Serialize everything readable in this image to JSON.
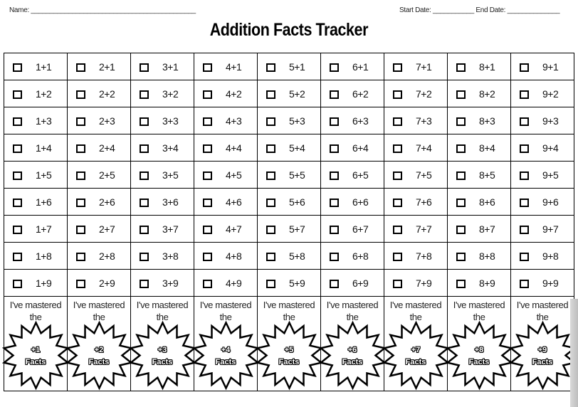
{
  "header": {
    "name_label": "Name: ____________________________________________",
    "dates_label": "Start Date: ___________  End Date: ______________",
    "title": "Addition Facts Tracker"
  },
  "grid": {
    "rows": [
      [
        "1+1",
        "2+1",
        "3+1",
        "4+1",
        "5+1",
        "6+1",
        "7+1",
        "8+1",
        "9+1"
      ],
      [
        "1+2",
        "2+2",
        "3+2",
        "4+2",
        "5+2",
        "6+2",
        "7+2",
        "8+2",
        "9+2"
      ],
      [
        "1+3",
        "2+3",
        "3+3",
        "4+3",
        "5+3",
        "6+3",
        "7+3",
        "8+3",
        "9+3"
      ],
      [
        "1+4",
        "2+4",
        "3+4",
        "4+4",
        "5+4",
        "6+4",
        "7+4",
        "8+4",
        "9+4"
      ],
      [
        "1+5",
        "2+5",
        "3+5",
        "4+5",
        "5+5",
        "6+5",
        "7+5",
        "8+5",
        "9+5"
      ],
      [
        "1+6",
        "2+6",
        "3+6",
        "4+6",
        "5+6",
        "6+6",
        "7+6",
        "8+6",
        "9+6"
      ],
      [
        "1+7",
        "2+7",
        "3+7",
        "4+7",
        "5+7",
        "6+7",
        "7+7",
        "8+7",
        "9+7"
      ],
      [
        "1+8",
        "2+8",
        "3+8",
        "4+8",
        "5+8",
        "6+8",
        "7+8",
        "8+8",
        "9+8"
      ],
      [
        "1+9",
        "2+9",
        "3+9",
        "4+9",
        "5+9",
        "6+9",
        "7+9",
        "8+9",
        "9+9"
      ]
    ],
    "checked": [
      [
        false,
        false,
        false,
        false,
        false,
        false,
        false,
        false,
        false
      ],
      [
        false,
        false,
        false,
        false,
        false,
        false,
        false,
        false,
        false
      ],
      [
        false,
        false,
        false,
        false,
        false,
        false,
        false,
        false,
        false
      ],
      [
        false,
        false,
        false,
        false,
        false,
        false,
        false,
        false,
        false
      ],
      [
        false,
        false,
        false,
        false,
        false,
        false,
        false,
        false,
        false
      ],
      [
        false,
        false,
        false,
        false,
        false,
        false,
        false,
        false,
        false
      ],
      [
        false,
        false,
        false,
        false,
        false,
        false,
        false,
        false,
        false
      ],
      [
        false,
        false,
        false,
        false,
        false,
        false,
        false,
        false,
        false
      ],
      [
        false,
        false,
        false,
        false,
        false,
        false,
        false,
        false,
        false
      ]
    ]
  },
  "badges": {
    "mastered_line1": "I've mastered",
    "mastered_line2": "the",
    "facts_word": "Facts",
    "items": [
      "+1",
      "+2",
      "+3",
      "+4",
      "+5",
      "+6",
      "+7",
      "+8",
      "+9"
    ]
  }
}
